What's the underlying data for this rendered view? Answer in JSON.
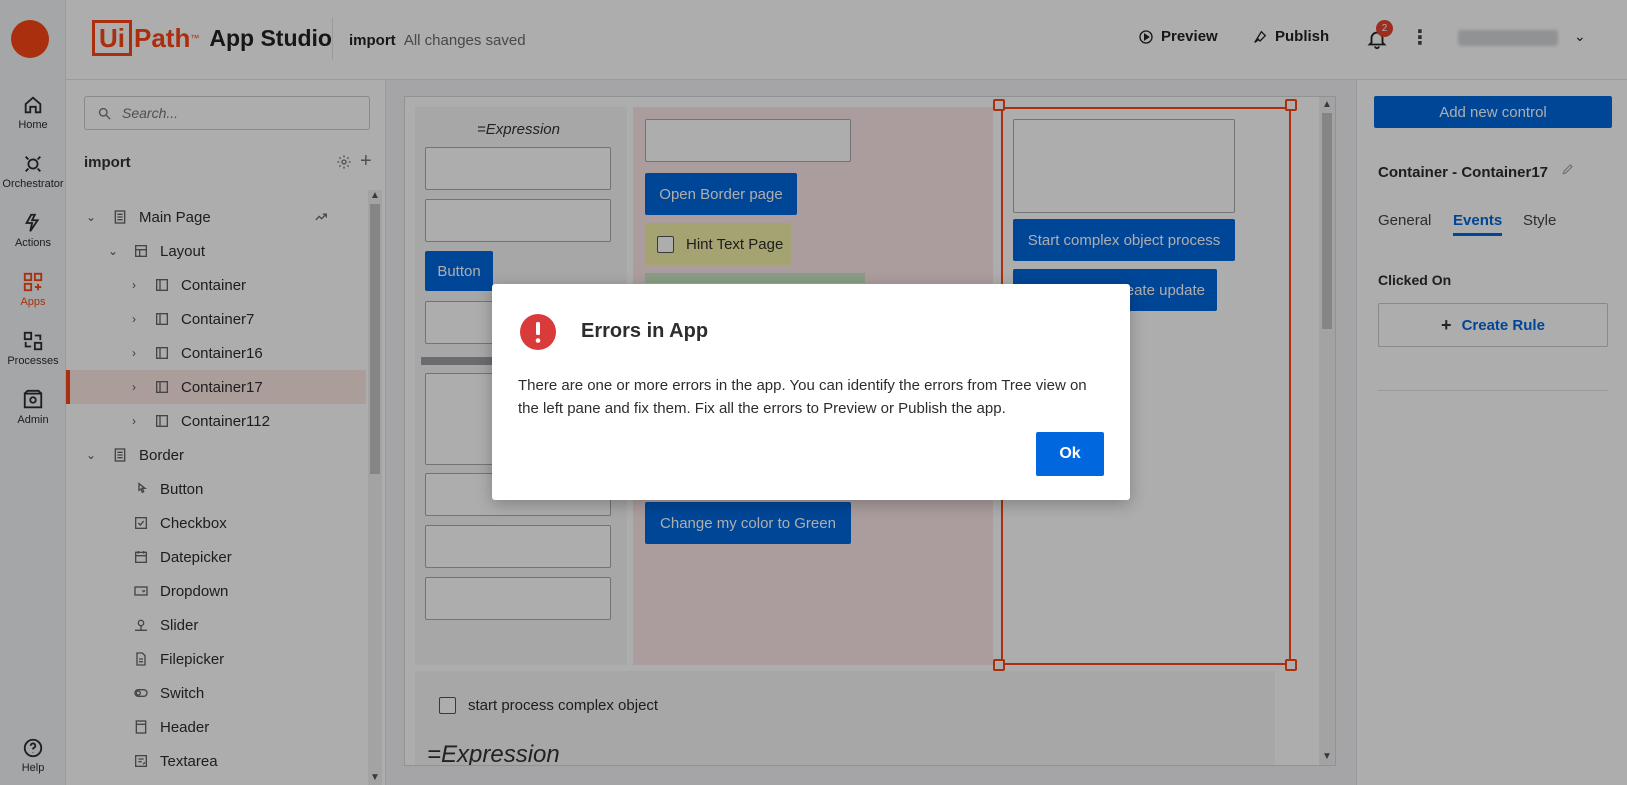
{
  "nav": {
    "items": [
      {
        "label": "Home",
        "icon": "home-icon"
      },
      {
        "label": "Orchestrator",
        "icon": "orchestrator-icon"
      },
      {
        "label": "Actions",
        "icon": "actions-icon"
      },
      {
        "label": "Apps",
        "icon": "apps-icon",
        "active": true
      },
      {
        "label": "Processes",
        "icon": "processes-icon"
      },
      {
        "label": "Admin",
        "icon": "admin-icon"
      }
    ],
    "help_label": "Help"
  },
  "header": {
    "brand_ui": "Ui",
    "brand_path": "Path",
    "brand_tm": "™",
    "brand_product": "App Studio",
    "project_name": "import",
    "save_status": "All changes saved",
    "preview_label": "Preview",
    "publish_label": "Publish",
    "notification_count": "2",
    "accent_color": "#fa4616"
  },
  "tree": {
    "search_placeholder": "Search...",
    "title": "import",
    "nodes": [
      {
        "label": "Main Page",
        "icon": "page-icon"
      },
      {
        "label": "Layout",
        "icon": "layout-icon"
      },
      {
        "label": "Container",
        "icon": "container-icon"
      },
      {
        "label": "Container7",
        "icon": "container-icon"
      },
      {
        "label": "Container16",
        "icon": "container-icon"
      },
      {
        "label": "Container17",
        "icon": "container-icon",
        "selected": true
      },
      {
        "label": "Container112",
        "icon": "container-icon"
      },
      {
        "label": "Border",
        "icon": "page-icon"
      },
      {
        "label": "Button",
        "icon": "button-icon"
      },
      {
        "label": "Checkbox",
        "icon": "checkbox-icon"
      },
      {
        "label": "Datepicker",
        "icon": "datepicker-icon"
      },
      {
        "label": "Dropdown",
        "icon": "dropdown-icon"
      },
      {
        "label": "Slider",
        "icon": "slider-icon"
      },
      {
        "label": "Filepicker",
        "icon": "filepicker-icon"
      },
      {
        "label": "Switch",
        "icon": "switch-icon"
      },
      {
        "label": "Header",
        "icon": "header-icon"
      },
      {
        "label": "Textarea",
        "icon": "textarea-icon"
      }
    ]
  },
  "canvas": {
    "expression_label": "=Expression",
    "button_label": "Button",
    "open_border_label": "Open Border page",
    "hint_text_label": "Hint Text Page",
    "change_color_label": "Change my color to Green",
    "start_complex_label": "Start complex object process",
    "create_update_label": "create update",
    "start_process_checkbox_label": "start process complex object",
    "bottom_expression": "=Expression"
  },
  "props": {
    "add_control_label": "Add new control",
    "control_title": "Container - Container17",
    "tabs": [
      "General",
      "Events",
      "Style"
    ],
    "active_tab": "Events",
    "clicked_on_label": "Clicked On",
    "create_rule_label": "Create Rule"
  },
  "modal": {
    "title": "Errors in App",
    "message": "There are one or more errors in the app. You can identify the errors from Tree view on the left pane and fix them. Fix all the errors to Preview or Publish the app.",
    "ok_label": "Ok",
    "icon": "error-icon",
    "error_color": "#d93a3a"
  }
}
